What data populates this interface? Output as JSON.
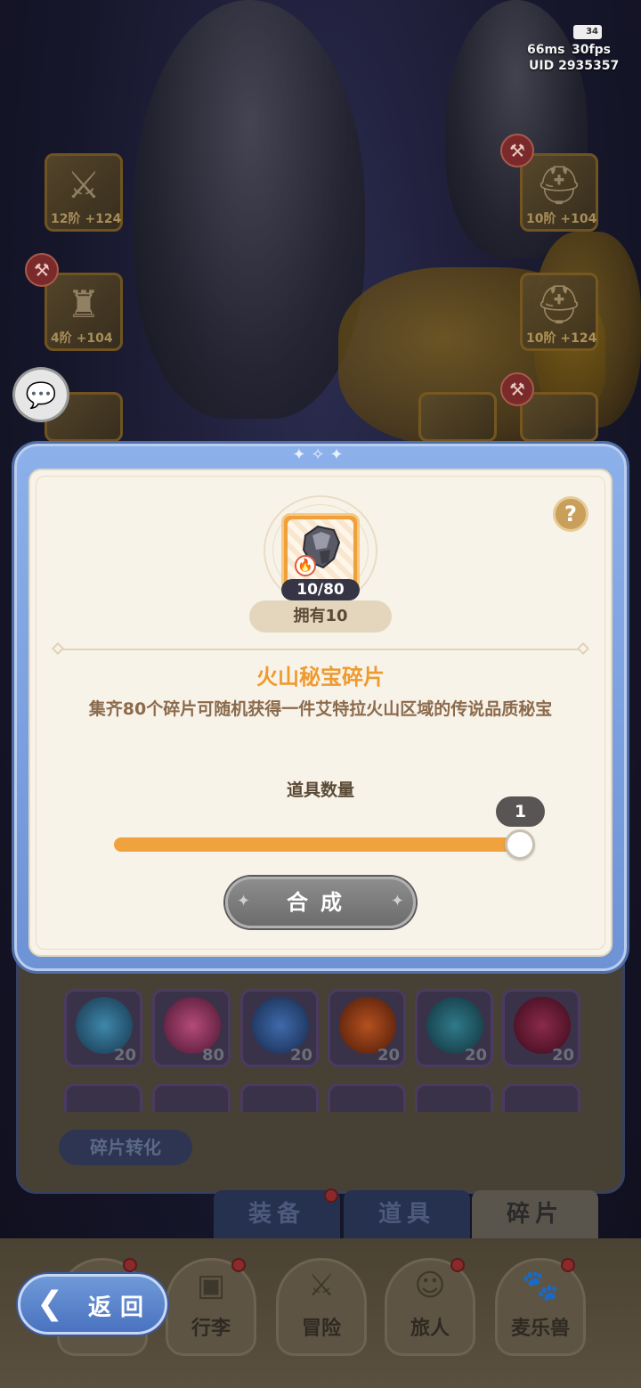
{
  "hud": {
    "battery": "34",
    "ping": "66ms",
    "fps": "30fps",
    "uid": "UID 2935357"
  },
  "equipment_slots": [
    {
      "icon": "sword-icon",
      "level": "12阶 +124"
    },
    {
      "icon": "helmet-icon",
      "level": "10阶 +104"
    },
    {
      "icon": "armor-icon",
      "level": "4阶 +104"
    },
    {
      "icon": "helmet-icon",
      "level": "10阶 +124"
    }
  ],
  "modal": {
    "item_count": "10/80",
    "owned_label": "拥有10",
    "item_name": "火山秘宝碎片",
    "item_description": "集齐80个碎片可随机获得一件艾特拉火山区域的传说品质秘宝",
    "quantity_label": "道具数量",
    "quantity_value": "1",
    "slider_fraction": 1.0,
    "synthesize_label": "合成",
    "help_label": "?"
  },
  "fragments": [
    {
      "count": "20",
      "color": "#2e6a8a"
    },
    {
      "count": "80",
      "color": "#8a2a5a"
    },
    {
      "count": "20",
      "color": "#2e5a8a"
    },
    {
      "count": "20",
      "color": "#8a3a1a"
    },
    {
      "count": "20",
      "color": "#1e5a6a"
    },
    {
      "count": "20",
      "color": "#6a1a3a"
    }
  ],
  "inventory": {
    "convert_label": "碎片转化",
    "tabs": [
      {
        "label": "装备",
        "active": false
      },
      {
        "label": "道具",
        "active": false
      },
      {
        "label": "碎片",
        "active": true
      }
    ]
  },
  "bottom_nav": {
    "back_label": "返回",
    "items": [
      {
        "label": "行李",
        "icon": "chest-icon"
      },
      {
        "label": "冒险",
        "icon": "crossed-swords-icon"
      },
      {
        "label": "旅人",
        "icon": "character-icon"
      },
      {
        "label": "麦乐兽",
        "icon": "pet-icon"
      }
    ]
  },
  "colors": {
    "accent_orange": "#f0a23e",
    "title_orange": "#ef9a2f",
    "modal_blue": "#7aa0e0",
    "panel_cream": "#f8f3e9"
  }
}
